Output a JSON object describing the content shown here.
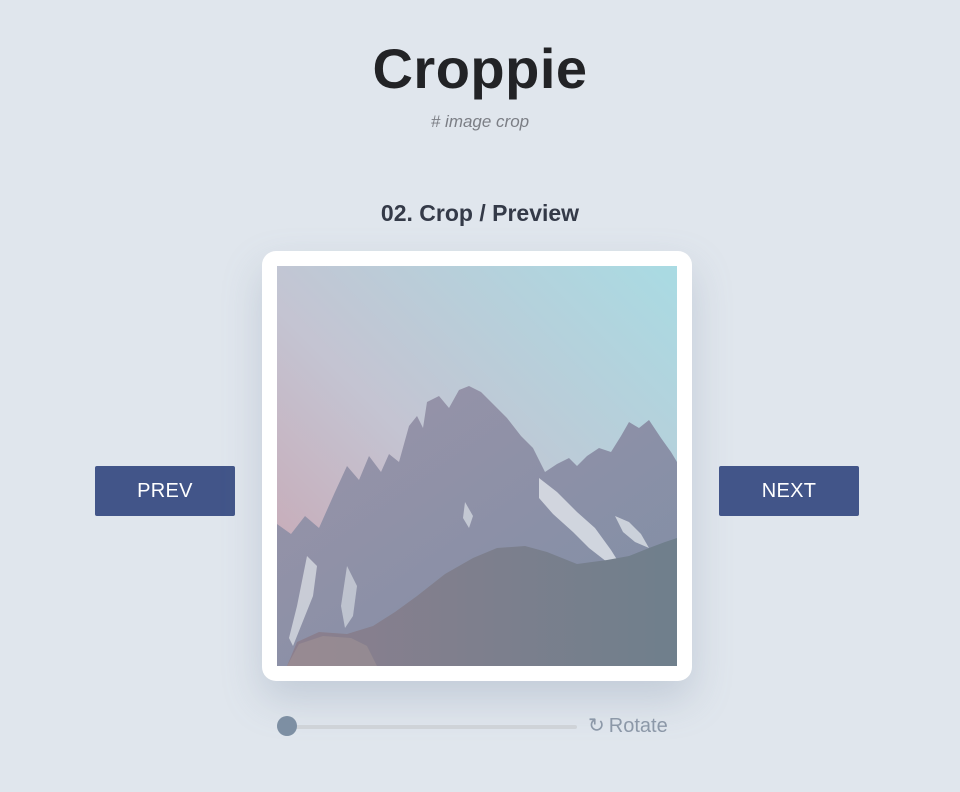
{
  "header": {
    "title": "Croppie",
    "subtitle": "# image crop"
  },
  "step": {
    "title": "02. Crop / Preview"
  },
  "nav": {
    "prev_label": "PREV",
    "next_label": "NEXT"
  },
  "crop": {
    "image_subject": "mountain peaks under pastel sky"
  },
  "zoom": {
    "level": 0
  },
  "rotate": {
    "label": "Rotate",
    "icon": "rotate-icon"
  },
  "colors": {
    "background": "#e0e6ed",
    "button": "#425589",
    "slider_thumb": "#7d8fa3"
  }
}
